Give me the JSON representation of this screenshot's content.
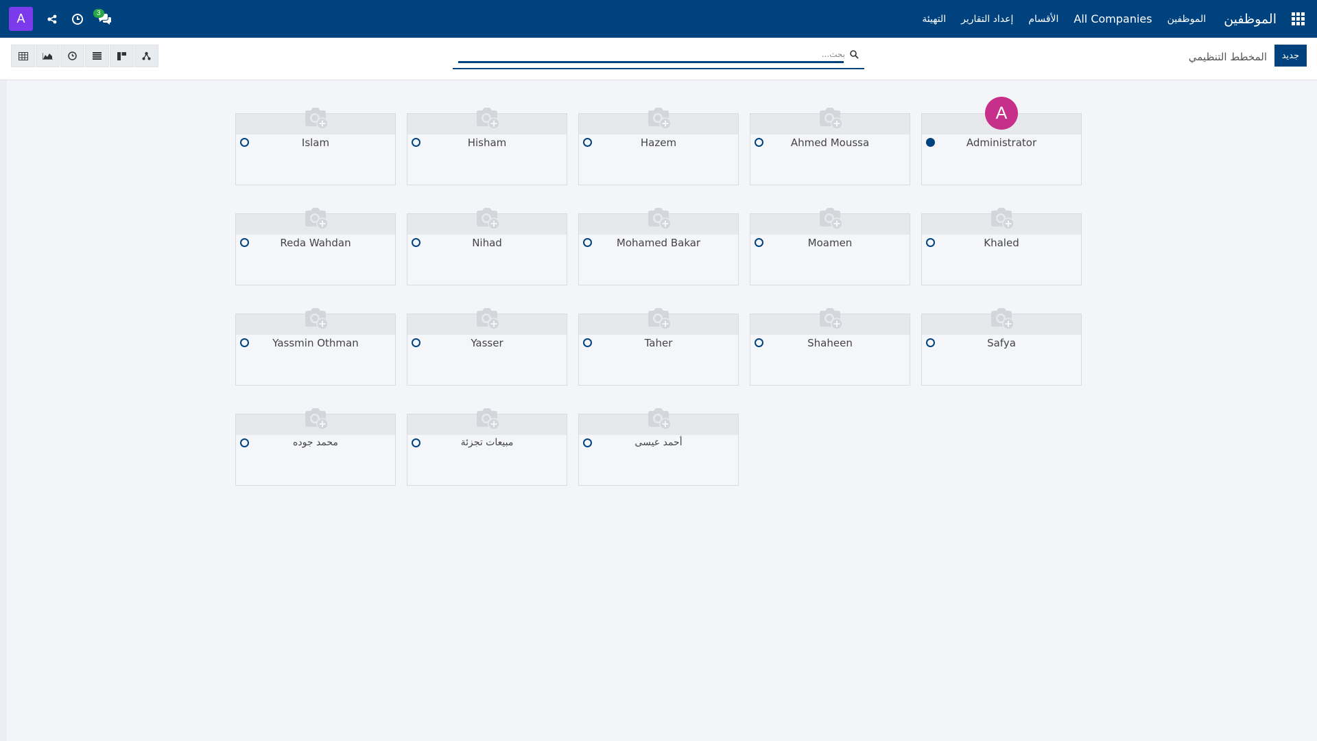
{
  "navbar": {
    "app_title": "الموظفين",
    "menu": [
      "الموظفين",
      "All Companies",
      "الأقسام",
      "إعداد التقارير",
      "التهيئة"
    ],
    "user_initial": "A",
    "chat_count": "3",
    "bg_color": "#00427e"
  },
  "control": {
    "new_button": "جديد",
    "breadcrumb": "المخطط التنظيمي",
    "search_placeholder": "بحث...",
    "views": [
      "activity-view-icon",
      "hierarchy-view-icon",
      "kanban-view-icon",
      "list-view-icon",
      "graph-view-icon",
      "pivot-view-icon"
    ]
  },
  "employees": [
    {
      "name": "Administrator",
      "status": "online",
      "avatar": "A",
      "avatar_color": "#c62f8a"
    },
    {
      "name": "Ahmed Moussa",
      "status": "offline"
    },
    {
      "name": "Hazem",
      "status": "offline"
    },
    {
      "name": "Hisham",
      "status": "offline"
    },
    {
      "name": "Islam",
      "status": "offline"
    },
    {
      "name": "Khaled",
      "status": "offline"
    },
    {
      "name": "Moamen",
      "status": "offline"
    },
    {
      "name": "Mohamed Bakar",
      "status": "offline"
    },
    {
      "name": "Nihad",
      "status": "offline"
    },
    {
      "name": "Reda Wahdan",
      "status": "offline"
    },
    {
      "name": "Safya",
      "status": "offline"
    },
    {
      "name": "Shaheen",
      "status": "offline"
    },
    {
      "name": "Taher",
      "status": "offline"
    },
    {
      "name": "Yasser",
      "status": "offline"
    },
    {
      "name": "Yassmin Othman",
      "status": "offline"
    },
    {
      "name": "أحمد عيسى",
      "status": "offline"
    },
    {
      "name": "مبيعات تجزئة",
      "status": "offline"
    },
    {
      "name": "محمد جوده",
      "status": "offline"
    }
  ]
}
